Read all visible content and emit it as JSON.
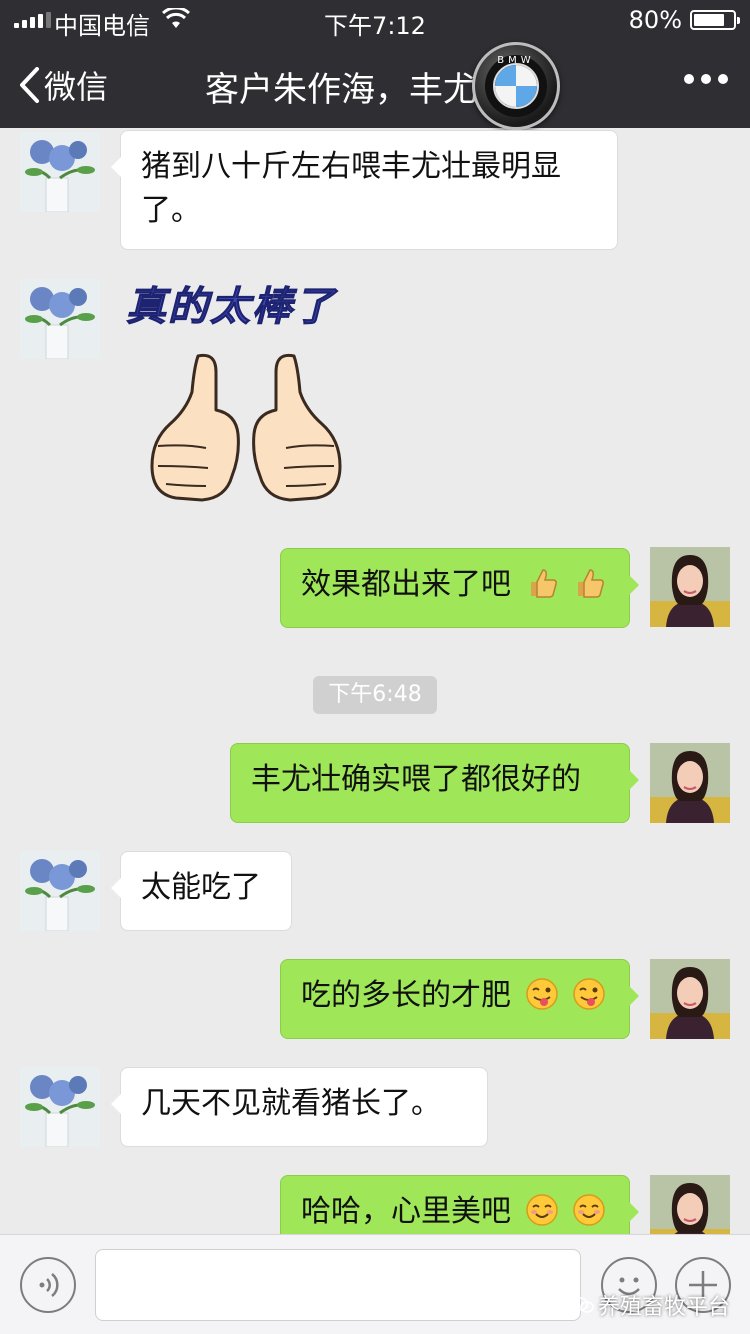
{
  "status_bar": {
    "carrier": "中国电信",
    "time": "下午7:12",
    "battery_percent": "80%",
    "battery_level": 0.8
  },
  "nav": {
    "back_label": "微信",
    "title": "客户朱作海，丰尤壮安",
    "logo_letters": "BMW"
  },
  "messages": [
    {
      "side": "left",
      "text": "猪到八十斤左右喂丰尤壮最明显了。"
    },
    {
      "side": "left",
      "type": "sticker",
      "sticker_text": "真的太棒了",
      "icon": "thumbs-up-sticker"
    },
    {
      "side": "right",
      "text": "效果都出来了吧",
      "emoji": [
        "thumbs-up-emoji",
        "thumbs-up-emoji"
      ]
    },
    {
      "type": "timestamp",
      "text": "下午6:48"
    },
    {
      "side": "right",
      "text": "丰尤壮确实喂了都很好的"
    },
    {
      "side": "left",
      "text": "太能吃了"
    },
    {
      "side": "right",
      "text": "吃的多长的才肥",
      "emoji": [
        "wink-tongue-emoji",
        "wink-tongue-emoji"
      ]
    },
    {
      "side": "left",
      "text": "几天不见就看猪长了。"
    },
    {
      "side": "right",
      "text": "哈哈，心里美吧",
      "emoji": [
        "smile-emoji",
        "smile-emoji"
      ]
    }
  ],
  "input_bar": {
    "watermark": "养殖畜牧平台"
  },
  "colors": {
    "nav_bg": "#2e2e33",
    "chat_bg": "#ebebeb",
    "bubble_right": "#9fe658",
    "bubble_left": "#ffffff"
  }
}
